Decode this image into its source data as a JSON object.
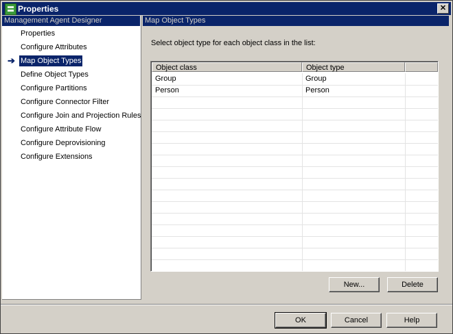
{
  "window": {
    "title": "Properties",
    "icon": "properties-app-icon",
    "close_glyph": "✕"
  },
  "left_panel": {
    "header": "Management Agent Designer",
    "arrow": "➔",
    "items": [
      {
        "label": "Properties"
      },
      {
        "label": "Configure Attributes"
      },
      {
        "label": "Map Object Types",
        "selected": true
      },
      {
        "label": "Define Object Types"
      },
      {
        "label": "Configure Partitions"
      },
      {
        "label": "Configure Connector Filter"
      },
      {
        "label": "Configure Join and Projection Rules"
      },
      {
        "label": "Configure Attribute Flow"
      },
      {
        "label": "Configure Deprovisioning"
      },
      {
        "label": "Configure Extensions"
      }
    ]
  },
  "right_panel": {
    "header": "Map Object Types",
    "instruction": "Select object type for each object class in the list:",
    "grid": {
      "columns": [
        "Object class",
        "Object type",
        ""
      ],
      "rows": [
        [
          "Group",
          "Group"
        ],
        [
          "Person",
          "Person"
        ]
      ]
    },
    "new_label": "New...",
    "delete_label": "Delete"
  },
  "footer": {
    "ok_label": "OK",
    "cancel_label": "Cancel",
    "help_label": "Help"
  }
}
